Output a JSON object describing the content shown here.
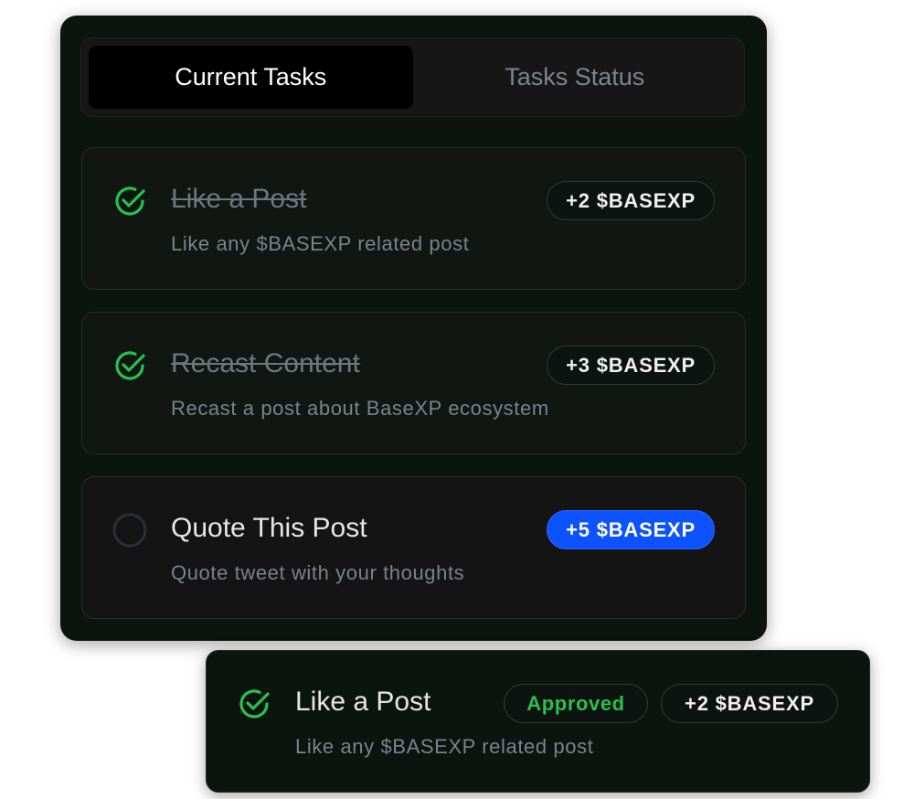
{
  "tabs": [
    {
      "label": "Current Tasks",
      "active": true
    },
    {
      "label": "Tasks Status",
      "active": false
    }
  ],
  "tasks": [
    {
      "title": "Like a Post",
      "description": "Like any $BASEXP related post",
      "reward": "+2 $BASEXP",
      "completed": true,
      "status_icon": "check-circle-icon"
    },
    {
      "title": "Recast Content",
      "description": "Recast a post about BaseXP ecosystem",
      "reward": "+3 $BASEXP",
      "completed": true,
      "status_icon": "check-circle-icon"
    },
    {
      "title": "Quote This Post",
      "description": "Quote tweet with your thoughts",
      "reward": "+5 $BASEXP",
      "completed": false,
      "status_icon": "empty-circle-icon"
    }
  ],
  "approved_card": {
    "title": "Like a Post",
    "description": "Like any $BASEXP related post",
    "status": "Approved",
    "reward": "+2 $BASEXP",
    "status_icon": "check-circle-icon"
  },
  "colors": {
    "panel_bg": "#0c140f",
    "success_green": "#27c24c",
    "accent_blue": "#0d52ff",
    "muted_text": "#7a828c"
  }
}
